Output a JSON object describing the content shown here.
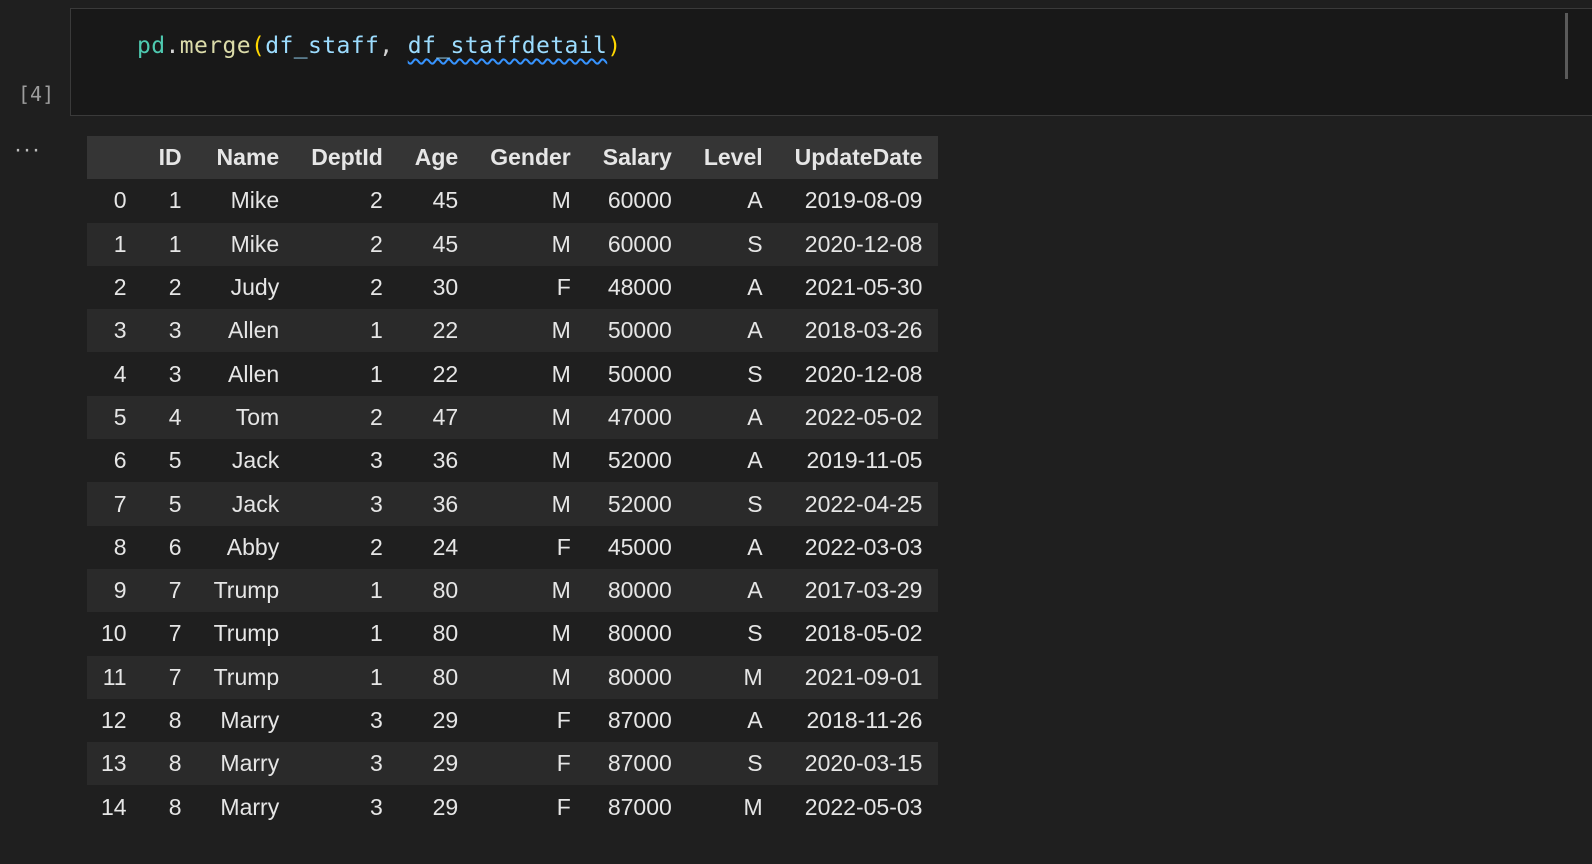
{
  "cell": {
    "execution_count": "[4]",
    "code": {
      "module": "pd",
      "dot": ".",
      "function": "merge",
      "open_paren": "(",
      "arg1": "df_staff",
      "comma": ", ",
      "arg2": "df_staffdetail",
      "close_paren": ")"
    },
    "output_menu": "···"
  },
  "table": {
    "columns": [
      "",
      "ID",
      "Name",
      "DeptId",
      "Age",
      "Gender",
      "Salary",
      "Level",
      "UpdateDate"
    ],
    "rows": [
      [
        "0",
        "1",
        "Mike",
        "2",
        "45",
        "M",
        "60000",
        "A",
        "2019-08-09"
      ],
      [
        "1",
        "1",
        "Mike",
        "2",
        "45",
        "M",
        "60000",
        "S",
        "2020-12-08"
      ],
      [
        "2",
        "2",
        "Judy",
        "2",
        "30",
        "F",
        "48000",
        "A",
        "2021-05-30"
      ],
      [
        "3",
        "3",
        "Allen",
        "1",
        "22",
        "M",
        "50000",
        "A",
        "2018-03-26"
      ],
      [
        "4",
        "3",
        "Allen",
        "1",
        "22",
        "M",
        "50000",
        "S",
        "2020-12-08"
      ],
      [
        "5",
        "4",
        "Tom",
        "2",
        "47",
        "M",
        "47000",
        "A",
        "2022-05-02"
      ],
      [
        "6",
        "5",
        "Jack",
        "3",
        "36",
        "M",
        "52000",
        "A",
        "2019-11-05"
      ],
      [
        "7",
        "5",
        "Jack",
        "3",
        "36",
        "M",
        "52000",
        "S",
        "2022-04-25"
      ],
      [
        "8",
        "6",
        "Abby",
        "2",
        "24",
        "F",
        "45000",
        "A",
        "2022-03-03"
      ],
      [
        "9",
        "7",
        "Trump",
        "1",
        "80",
        "M",
        "80000",
        "A",
        "2017-03-29"
      ],
      [
        "10",
        "7",
        "Trump",
        "1",
        "80",
        "M",
        "80000",
        "S",
        "2018-05-02"
      ],
      [
        "11",
        "7",
        "Trump",
        "1",
        "80",
        "M",
        "80000",
        "M",
        "2021-09-01"
      ],
      [
        "12",
        "8",
        "Marry",
        "3",
        "29",
        "F",
        "87000",
        "A",
        "2018-11-26"
      ],
      [
        "13",
        "8",
        "Marry",
        "3",
        "29",
        "F",
        "87000",
        "S",
        "2020-03-15"
      ],
      [
        "14",
        "8",
        "Marry",
        "3",
        "29",
        "F",
        "87000",
        "M",
        "2022-05-03"
      ]
    ]
  },
  "colors": {
    "background": "#1f1f1f",
    "cell_background": "#181818",
    "header_background": "#353535",
    "row_stripe": "#2a2a2a",
    "function": "#dcdcaa",
    "module": "#4ec9b0",
    "variable": "#9cdcfe",
    "bracket": "#ffd700",
    "warning_squiggle": "#3794ff"
  }
}
